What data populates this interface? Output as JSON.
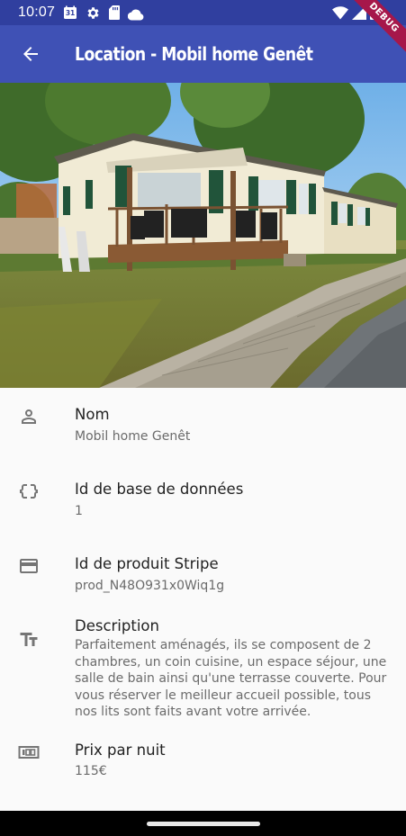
{
  "status_bar": {
    "time": "10:07",
    "calendar_day": "31",
    "left_icons": [
      "calendar-icon",
      "gear-icon",
      "sd-card-icon",
      "cloud-icon"
    ],
    "right_icons": [
      "wifi-icon",
      "cell-signal-icon",
      "battery-icon"
    ]
  },
  "app_bar": {
    "title": "Location - Mobil home Genêt",
    "back_icon": "arrow-back-icon",
    "debug_label": "DEBUG"
  },
  "photo": {
    "description_icon": "mobile-home-photo"
  },
  "details": [
    {
      "icon": "person-icon",
      "label": "Nom",
      "value": "Mobil home Genêt"
    },
    {
      "icon": "data-object-icon",
      "label": "Id de base de données",
      "value": "1"
    },
    {
      "icon": "credit-card-icon",
      "label": "Id de produit Stripe",
      "value": "prod_N48O931x0Wiq1g"
    },
    {
      "icon": "text-fields-icon",
      "label": "Description",
      "value": "Parfaitement aménagés, ils se composent de 2 chambres, un coin cuisine, un espace séjour, une salle de bain ainsi qu'une terrasse couverte. Pour vous réserver le meilleur accueil possible, tous nos lits sont faits avant votre arrivée."
    },
    {
      "icon": "price-icon",
      "label": "Prix par nuit",
      "value": "115€"
    }
  ],
  "colors": {
    "status_bar": "#303f9f",
    "app_bar": "#3f51b5",
    "debug_banner": "#a6174a",
    "background": "#fafafa"
  }
}
